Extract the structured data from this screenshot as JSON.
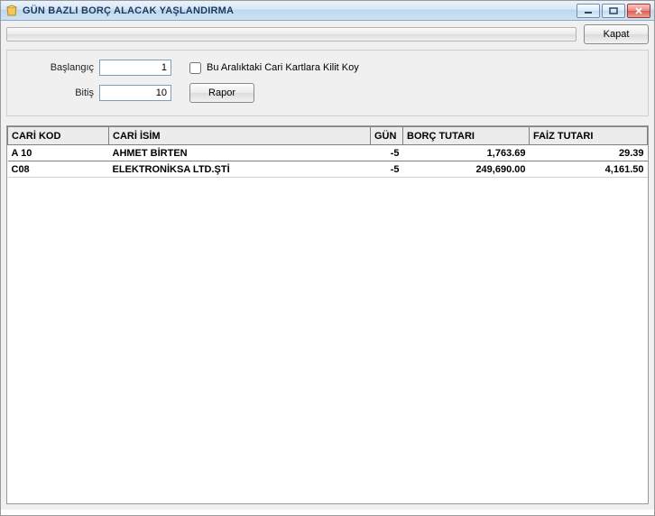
{
  "window": {
    "title": "GÜN BAZLI BORÇ ALACAK YAŞLANDIRMA"
  },
  "buttons": {
    "close": "Kapat",
    "report": "Rapor"
  },
  "form": {
    "start_label": "Başlangıç",
    "start_value": "1",
    "end_label": "Bitiş",
    "end_value": "10",
    "lock_label": "Bu Aralıktaki Cari Kartlara Kilit Koy"
  },
  "columns": {
    "kod": "CARİ KOD",
    "isim": "CARİ İSİM",
    "gun": "GÜN",
    "borc": "BORÇ TUTARI",
    "faiz": "FAİZ TUTARI"
  },
  "rows": [
    {
      "kod": "A 10",
      "isim": "AHMET BİRTEN",
      "gun": "-5",
      "borc": "1,763.69",
      "faiz": "29.39"
    },
    {
      "kod": "C08",
      "isim": "ELEKTRONİKSA LTD.ŞTİ",
      "gun": "-5",
      "borc": "249,690.00",
      "faiz": "4,161.50"
    }
  ]
}
